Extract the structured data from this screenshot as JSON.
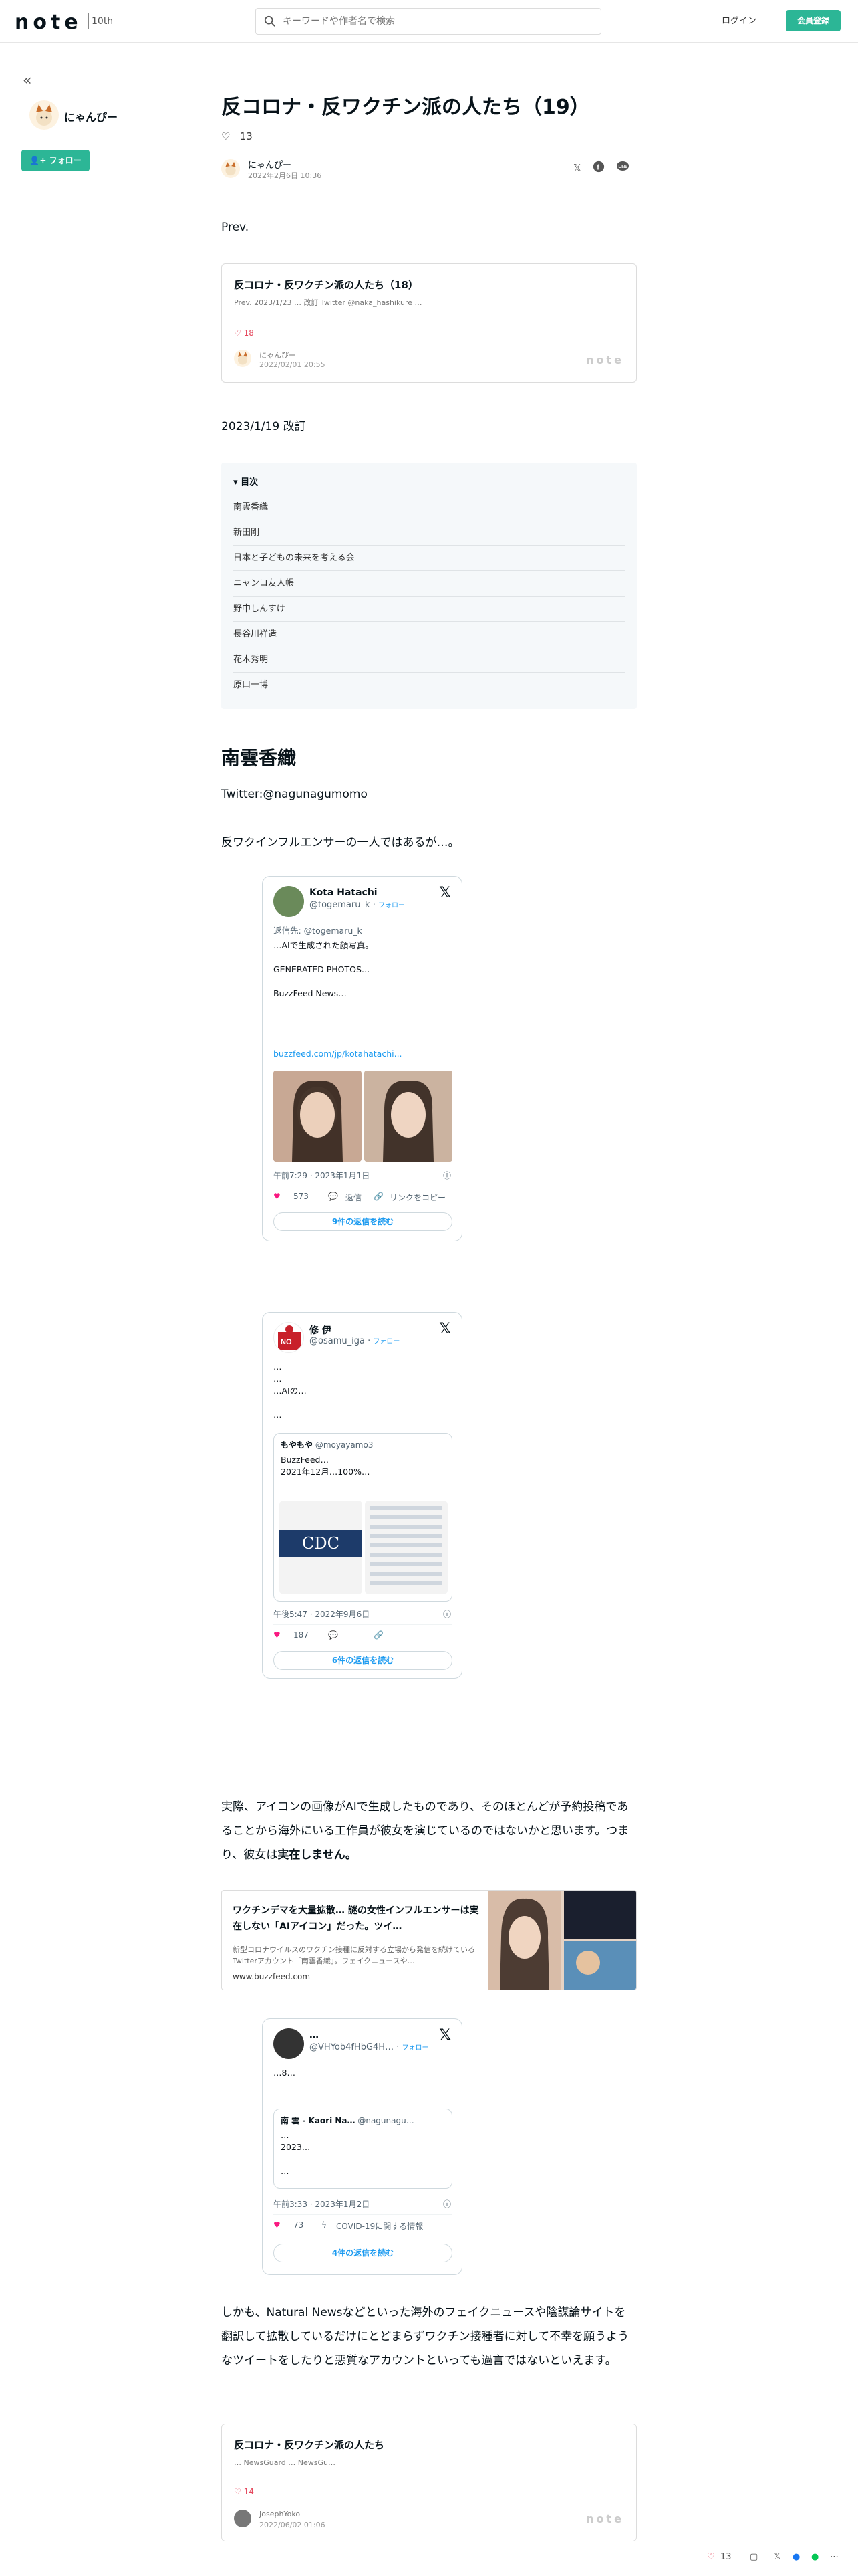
{
  "header": {
    "logo": "note",
    "logo_badge": "10th",
    "search_placeholder": "キーワードや作者名で検索",
    "login": "ログイン",
    "signup": "会員登録"
  },
  "sidebar": {
    "creator_name": "にゃんぴー",
    "follow": "フォロー"
  },
  "article": {
    "title": "反コロナ・反ワクチン派の人たち（19）",
    "likes": "13",
    "author": "にゃんぴー",
    "date": "2022年2月6日 10:36",
    "intro": "Prev.",
    "revision": "2023/1/19 改訂",
    "section_heading": "南雲香織",
    "twitter_line": "Twitter:@nagunagumomo",
    "lead": "反ワクインフルエンサーの一人ではあるが…。",
    "para1_a": "実際、アイコンの画像がAIで生成したものであり、そのほとんどが予約投稿であることから海外にいる工作員が彼女を演じているのではないかと思います。つまり、彼女は",
    "para1_b": "実在しません。",
    "para2": "しかも、Natural Newsなどといった海外のフェイクニュースや陰謀論サイトを翻訳して拡散しているだけにとどまらずワクチン接種者に対して不幸を願うようなツイートをしたりと悪質なアカウントといっても過言ではないといえます。"
  },
  "prev_card": {
    "title": "反コロナ・反ワクチン派の人たち（18）",
    "desc": "Prev. 2023/1/23 … 改訂 Twitter @naka_hashikure …",
    "likes": "18",
    "author": "にゃんぴー",
    "date": "2022/02/01 20:55",
    "brand": "note"
  },
  "toc": {
    "heading": "目次",
    "items": [
      "南雲香織",
      "新田剛",
      "日本と子どもの未来を考える会",
      "ニャンコ友人帳",
      "野中しんすけ",
      "長谷川祥造",
      "花木秀明",
      "原口一博"
    ]
  },
  "tweet1": {
    "name": "Kota Hatachi",
    "handle": "@togemaru_k",
    "follow": "フォロー",
    "reply_to": "返信先: @togemaru_k",
    "text": "…AIで生成された顔写真。\n\nGENERATED PHOTOS…\n\nBuzzFeed News…",
    "link": "buzzfeed.com/jp/kotahatachi...",
    "time": "午前7:29 · 2023年1月1日",
    "likes": "573",
    "reply": "返信",
    "copy": "リンクをコピー",
    "read_replies": "9件の返信を読む"
  },
  "tweet2": {
    "name": "修 伊",
    "handle": "@osamu_iga",
    "follow": "フォロー",
    "text": "…\n…\n…AIの…\n\n…",
    "quote_name": "もやもや",
    "quote_handle": "@moyayamo3",
    "quote_text": "BuzzFeed…\n2021年12月…100%…",
    "time": "午後5:47 · 2022年9月6日",
    "likes": "187",
    "read_replies": "6件の返信を読む",
    "quote_img_label": "CDC"
  },
  "linkcard": {
    "title": "ワクチンデマを大量拡散… 謎の女性インフルエンサーは実在しない「AIアイコン」だった。ツイ…",
    "desc": "新型コロナウイルスのワクチン接種に反対する立場から発信を続けているTwitterアカウント「南雲香織」。フェイクニュースや…",
    "url": "www.buzzfeed.com"
  },
  "tweet3": {
    "name": "…",
    "handle": "@VHYob4fHbG4H…",
    "follow": "フォロー",
    "text": "…8…",
    "quote_name": "南 雲 - Kaori Na…",
    "quote_handle": "@nagunagu…",
    "quote_text": "…\n2023…\n\n…",
    "time": "午前3:33 · 2023年1月2日",
    "likes": "73",
    "covid": "COVID-19に関する情報",
    "read_replies": "4件の返信を読む"
  },
  "next_card": {
    "title": "反コロナ・反ワクチン派の人たち",
    "desc": "… NewsGuard … NewsGu…",
    "likes": "14",
    "author": "JosephYoko",
    "date": "2022/06/02 01:06",
    "brand": "note"
  },
  "floating_bar": {
    "likes": "13"
  }
}
